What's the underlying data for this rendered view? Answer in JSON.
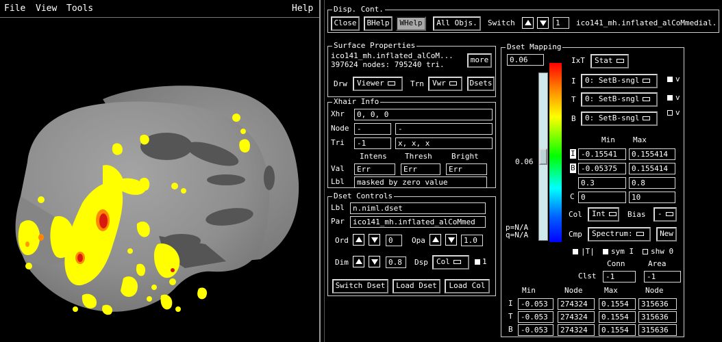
{
  "menubar": {
    "file": "File",
    "view": "View",
    "tools": "Tools",
    "help": "Help"
  },
  "disp_cont": {
    "title": "Disp. Cont.",
    "close": "Close",
    "bhelp": "BHelp",
    "whelp": "WHelp",
    "all_objs": "All Objs.",
    "switch_label": "Switch",
    "switch_value": "1",
    "surface_name": "ico141_mh.inflated_alCoMmedial."
  },
  "surface_props": {
    "title": "Surface Properties",
    "line1": "ico141_mh.inflated_alCoM...",
    "line2": "397624 nodes: 795240 tri.",
    "more": "more",
    "drw_label": "Drw",
    "drw_value": "Viewer",
    "trn_label": "Trn",
    "trn_value": "Vwr",
    "dsets": "Dsets"
  },
  "xhair": {
    "title": "Xhair Info",
    "xhr_label": "Xhr",
    "xhr_value": "0, 0, 0",
    "node_label": "Node",
    "node_value": "-",
    "node_value2": "-",
    "tri_label": "Tri",
    "tri_value": "-1",
    "tri_value2": "x, x, x",
    "col_intens": "Intens",
    "col_thresh": "Thresh",
    "col_bright": "Bright",
    "val_label": "Val",
    "val_intens": "Err",
    "val_thresh": "Err",
    "val_bright": "Err",
    "lbl_label": "Lbl",
    "lbl_value": "masked by zero value"
  },
  "dset_controls": {
    "title": "Dset Controls",
    "lbl_label": "Lbl",
    "lbl_value": "n.niml.dset",
    "par_label": "Par",
    "par_value": "ico141_mh.inflated_alCoMmed",
    "ord_label": "Ord",
    "ord_value": "0",
    "opa_label": "Opa",
    "opa_value": "1.0",
    "dim_label": "Dim",
    "dim_value": "0.8",
    "dsp_label": "Dsp",
    "dsp_value": "Col",
    "one_label": "1",
    "switch_dset": "Switch Dset",
    "load_dset": "Load Dset",
    "load_col": "Load Col"
  },
  "dset_mapping": {
    "title": "Dset Mapping",
    "top_value": "0.06",
    "mid_value": "0.06",
    "ixt_label": "IxT",
    "ixt_value": "Stat",
    "i_label": "I",
    "i_value": "0: SetB-sngl",
    "t_label": "T",
    "t_value": "0: SetB-sngl",
    "b_label": "B",
    "b_value": "0: SetB-sngl",
    "v_label": "v",
    "min_header": "Min",
    "max_header": "Max",
    "i_min": "-0.15541",
    "i_max": "0.155414",
    "b_min": "-0.05375",
    "b_max": "0.155414",
    "r3_min": "0.3",
    "r3_max": "0.8",
    "c_label": "C",
    "c_min": "0",
    "c_max": "10",
    "col_label": "Col",
    "col_value": "Int",
    "bias_label": "Bias",
    "bias_value": "-",
    "cmp_label": "Cmp",
    "cmp_value": "Spectrum:",
    "new": "New",
    "p_text": "p=N/A",
    "q_text": "q=N/A",
    "abs_i": "|T|",
    "sym_i": "sym I",
    "shw0": "shw 0",
    "conn_header": "Conn",
    "area_header": "Area",
    "clst_label": "Clst",
    "clst_conn": "-1",
    "clst_area": "-1",
    "tbl_headers": [
      "Min",
      "Node",
      "Max",
      "Node"
    ],
    "tbl_rows": [
      {
        "label": "I",
        "min": "-0.053",
        "node1": "274324",
        "max": "0.1554",
        "node2": "315636"
      },
      {
        "label": "T",
        "min": "-0.053",
        "node1": "274324",
        "max": "0.1554",
        "node2": "315636"
      },
      {
        "label": "B",
        "min": "-0.053",
        "node1": "274324",
        "max": "0.1554",
        "node2": "315636"
      }
    ]
  },
  "colors": {
    "background": "#000000",
    "surface": "#8f8f8f",
    "overlay_yellow": "#ffff00",
    "overlay_red": "#d91a10"
  }
}
